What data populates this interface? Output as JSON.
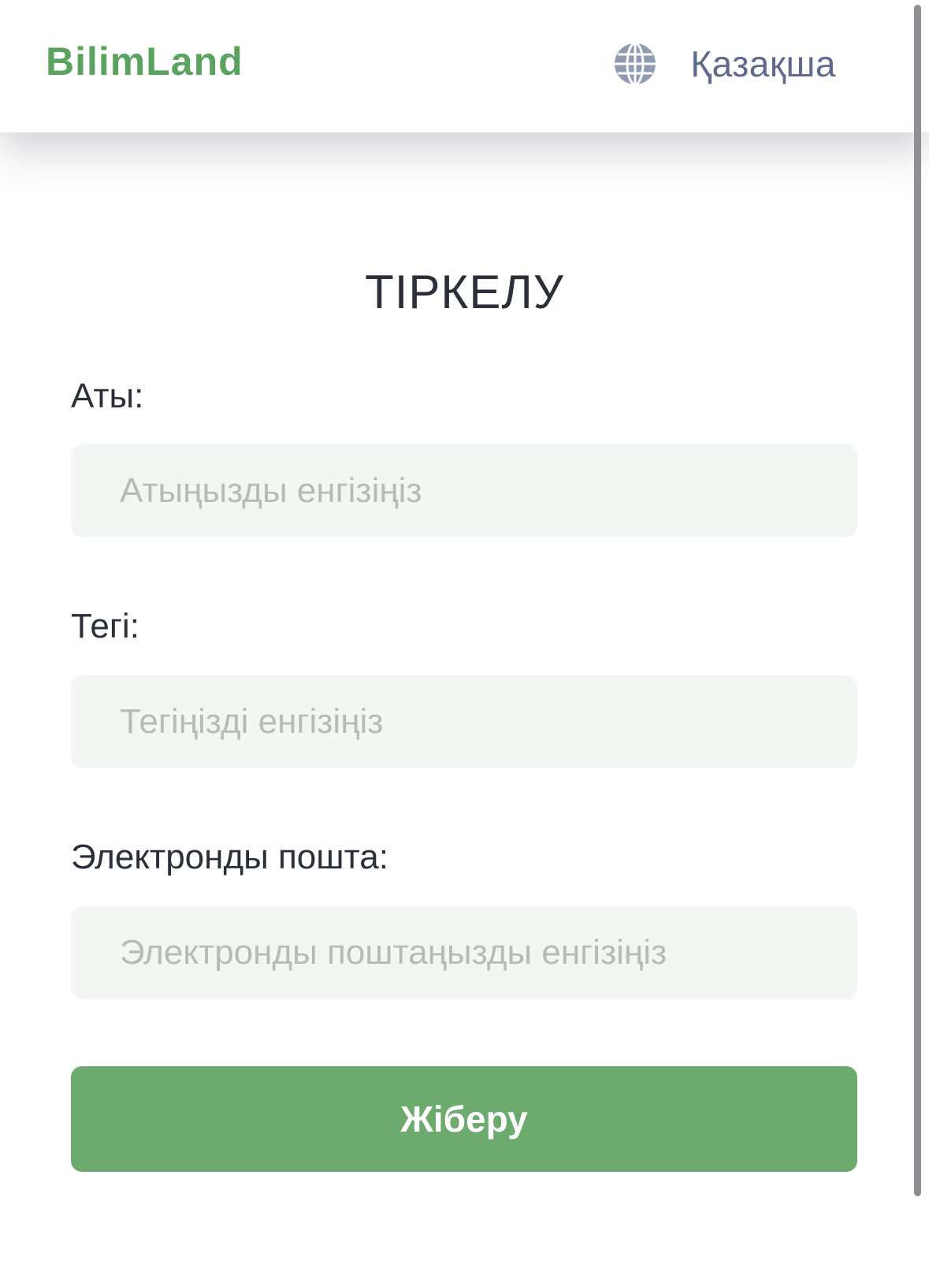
{
  "header": {
    "logo_text": "BilimLand",
    "language_icon": "globe-icon",
    "language_label": "Қазақша"
  },
  "form": {
    "title": "ТІРКЕЛУ",
    "first_name": {
      "label": "Аты:",
      "placeholder": "Атыңызды енгізіңіз",
      "value": ""
    },
    "last_name": {
      "label": "Тегі:",
      "placeholder": "Тегіңізді енгізіңіз",
      "value": ""
    },
    "email": {
      "label": "Электронды пошта:",
      "placeholder": "Электронды поштаңызды енгізіңіз",
      "value": ""
    },
    "submit_label": "Жіберу"
  },
  "colors": {
    "brand_green": "#5aa35e",
    "button_green": "#6caa6e",
    "input_bg": "#f3f7f3",
    "text_dark": "#2b2f3a",
    "language_text": "#5f6a8c",
    "placeholder": "#b5bcb7"
  }
}
